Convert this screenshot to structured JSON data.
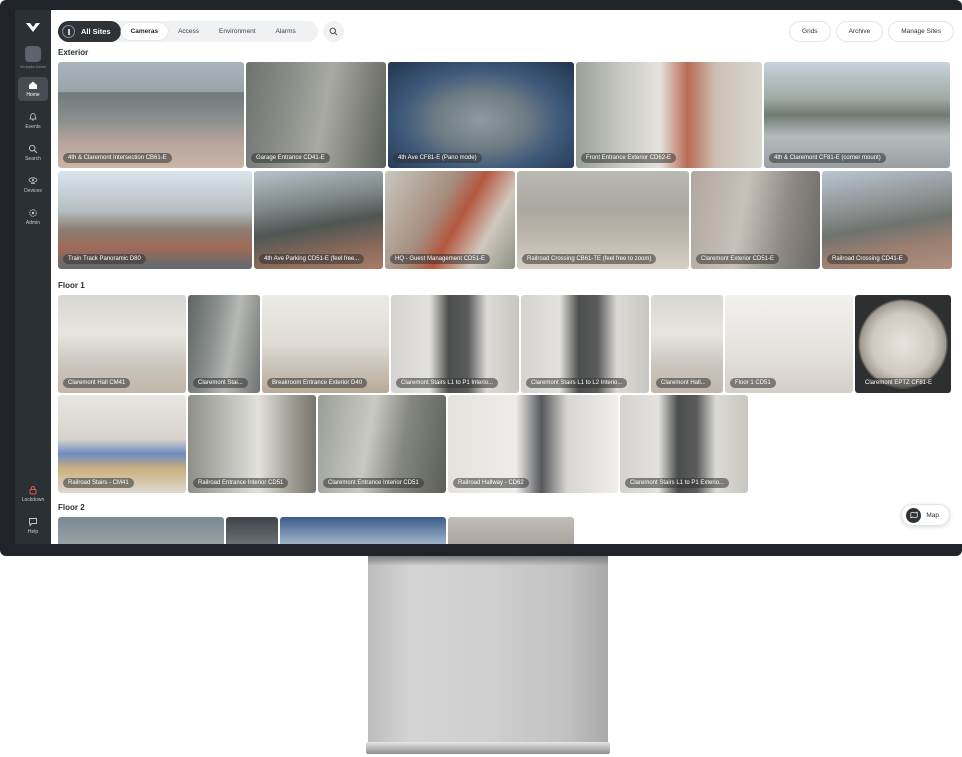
{
  "sidebar": {
    "org_label": "Verkada Demo",
    "items": [
      {
        "label": "Home",
        "icon": "home-icon"
      },
      {
        "label": "Events",
        "icon": "bell-icon"
      },
      {
        "label": "Search",
        "icon": "search-icon"
      },
      {
        "label": "Devices",
        "icon": "devices-icon"
      },
      {
        "label": "Admin",
        "icon": "gear-icon"
      }
    ],
    "bottom": [
      {
        "label": "Lockdown",
        "icon": "lock-icon"
      },
      {
        "label": "Help",
        "icon": "chat-icon"
      }
    ]
  },
  "header": {
    "site_selector": "All Sites",
    "tabs": [
      "Cameras",
      "Access",
      "Environment",
      "Alarms"
    ],
    "active_tab": "Cameras",
    "buttons": [
      "Grids",
      "Archive",
      "Manage Sites"
    ]
  },
  "sections": [
    {
      "title": "Exterior",
      "rows": [
        [
          {
            "label": "4th & Claremont Intersection CB61-E"
          },
          {
            "label": "Garage Entrance CD41-E"
          },
          {
            "label": "4th Ave CF81-E (Pano mode)"
          },
          {
            "label": "Front Entrance Exterior CD62-E"
          },
          {
            "label": "4th & Claremont CF81-E (corner mount)"
          }
        ],
        [
          {
            "label": "Train Track Panoramic D80"
          },
          {
            "label": "4th Ave Parking CD51-E (feel free..."
          },
          {
            "label": "HQ - Guest Management CD51-E"
          },
          {
            "label": "Railroad Crossing CB61-TE (feel free to zoom)"
          },
          {
            "label": "Claremont Exterior CD51-E"
          },
          {
            "label": "Railroad Crossing CD41-E"
          }
        ]
      ]
    },
    {
      "title": "Floor 1",
      "rows": [
        [
          {
            "label": "Claremont Hall CM41"
          },
          {
            "label": "Claremont Stai..."
          },
          {
            "label": "Breakroom Entrance Exterior D40"
          },
          {
            "label": "Claremont Stairs L1 to P1 Interio..."
          },
          {
            "label": "Claremont Stairs L1 to L2 Interio..."
          },
          {
            "label": "Claremont Hall..."
          },
          {
            "label": "Floor 1 CD51"
          },
          {
            "label": "Claremont EPTZ CF81-E"
          }
        ],
        [
          {
            "label": "Railroad Stairs - CM41"
          },
          {
            "label": "Railroad Entrance Interior CD51"
          },
          {
            "label": "Claremont Entrance Interior CD51"
          },
          {
            "label": "Railroad Hallway - CD62"
          },
          {
            "label": "Claremont Stairs L1 to P1 Exterio..."
          }
        ]
      ]
    },
    {
      "title": "Floor 2"
    }
  ],
  "map_button": "Map"
}
